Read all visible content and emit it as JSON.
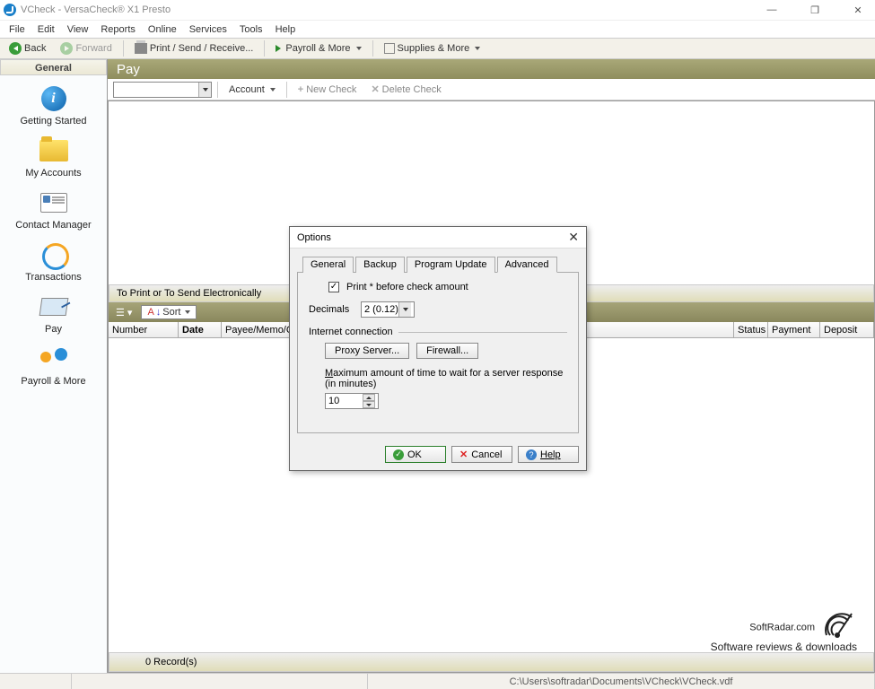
{
  "window": {
    "title": "VCheck - VersaCheck® X1 Presto"
  },
  "winbtns": {
    "min": "—",
    "max": "❐",
    "close": "✕"
  },
  "menu": [
    "File",
    "Edit",
    "View",
    "Reports",
    "Online",
    "Services",
    "Tools",
    "Help"
  ],
  "toolbar": {
    "back": "Back",
    "forward": "Forward",
    "print": "Print / Send / Receive...",
    "payroll": "Payroll & More",
    "supplies": "Supplies & More"
  },
  "sidebar": {
    "header": "General",
    "items": [
      {
        "label": "Getting Started"
      },
      {
        "label": "My Accounts"
      },
      {
        "label": "Contact Manager"
      },
      {
        "label": "Transactions"
      },
      {
        "label": "Pay"
      },
      {
        "label": "Payroll & More"
      }
    ]
  },
  "main": {
    "title": "Pay",
    "account_btn": "Account",
    "new_check": "New Check",
    "delete_check": "Delete Check",
    "print_header": "To Print or To Send Electronically",
    "sort": "Sort",
    "columns": {
      "number": "Number",
      "date": "Date",
      "payee": "Payee/Memo/Category",
      "status": "Status",
      "payment": "Payment",
      "deposit": "Deposit"
    },
    "records": "0 Record(s)"
  },
  "dialog": {
    "title": "Options",
    "close": "✕",
    "tabs": {
      "general": "General",
      "backup": "Backup",
      "program_update": "Program Update",
      "advanced": "Advanced"
    },
    "adv": {
      "print_star": "Print * before check amount",
      "decimals_lbl": "Decimals",
      "decimals_val": "2 (0.12)",
      "inet_group": "Internet connection",
      "proxy": "Proxy Server...",
      "firewall": "Firewall...",
      "timeout_lbl": "Maximum amount of time to wait for a server response (in minutes)",
      "timeout_val": "10"
    },
    "buttons": {
      "ok": "OK",
      "cancel": "Cancel",
      "help": "Help"
    }
  },
  "status": {
    "path": "C:\\Users\\softradar\\Documents\\VCheck\\VCheck.vdf"
  },
  "watermark": {
    "big": "SoftRadar.com",
    "sm": "Software reviews & downloads"
  }
}
